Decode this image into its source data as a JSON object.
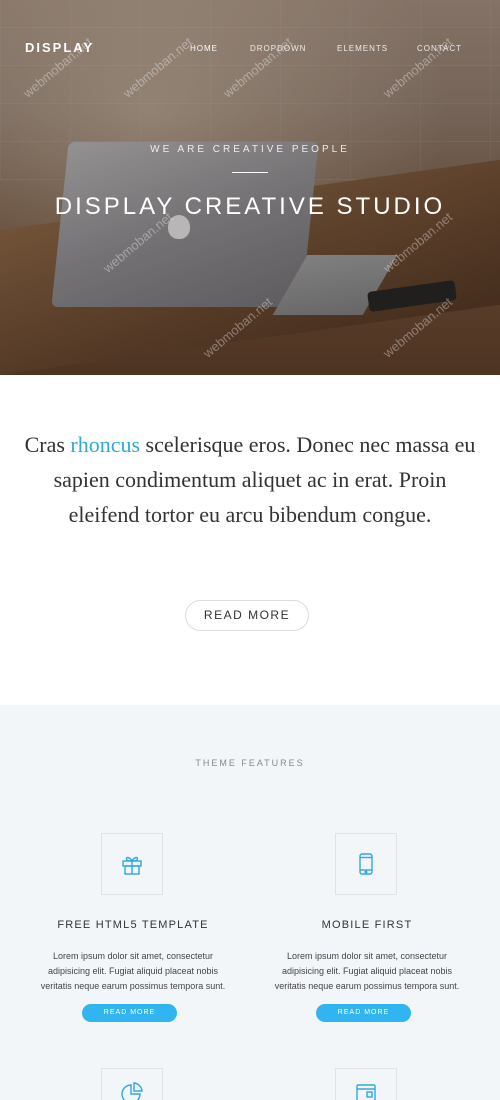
{
  "nav": {
    "brand": "DISPLAY",
    "items": [
      {
        "label": "HOME",
        "active": true
      },
      {
        "label": "DROPDOWN",
        "active": false
      },
      {
        "label": "ELEMENTS",
        "active": false
      },
      {
        "label": "CONTACT",
        "active": false
      }
    ]
  },
  "hero": {
    "tagline": "WE ARE CREATIVE PEOPLE",
    "title": "DISPLAY CREATIVE STUDIO"
  },
  "intro": {
    "text_before": "Cras ",
    "accent_word": "rhoncus",
    "text_after": " scelerisque eros. Donec nec massa eu sapien condimentum aliquet ac in erat. Proin eleifend tortor eu arcu bibendum congue.",
    "button_label": "READ MORE",
    "accent_color": "#2fa8e0"
  },
  "features": {
    "section_title": "THEME FEATURES",
    "cards": [
      {
        "icon": "gift-icon",
        "title": "FREE HTML5 TEMPLATE",
        "text": "Lorem ipsum dolor sit amet, consectetur adipisicing elit. Fugiat aliquid placeat nobis veritatis neque earum possimus tempora sunt.",
        "button_label": "READ MORE"
      },
      {
        "icon": "mobile-phone-icon",
        "title": "MOBILE FIRST",
        "text": "Lorem ipsum dolor sit amet, consectetur adipisicing elit. Fugiat aliquid placeat nobis veritatis neque earum possimus tempora sunt.",
        "button_label": "READ MORE"
      }
    ],
    "partial_icons": [
      "pie-chart-icon",
      "browser-window-icon"
    ],
    "button_color": "#30b5f0"
  },
  "watermark": "webmoban.net"
}
